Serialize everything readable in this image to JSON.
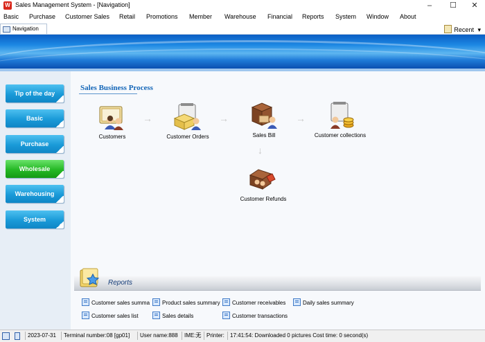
{
  "window": {
    "app_icon": "app-logo-icon",
    "app_icon_letter": "W",
    "title": "Sales Management System - [Navigation]",
    "controls": {
      "minimize": "–",
      "maximize": "☐",
      "close": "✕"
    }
  },
  "menu": [
    "Basic",
    "Purchase",
    "Customer Sales",
    "Retail",
    "Promotions",
    "Member",
    "Warehouse",
    "Financial",
    "Reports",
    "System",
    "Window",
    "About"
  ],
  "tabs": {
    "navigation": "Navigation",
    "recent": "Recent",
    "recent_arrow": "▾"
  },
  "sidebar": {
    "items": [
      {
        "label": "Tip of the day",
        "active": false
      },
      {
        "label": "Basic",
        "active": false
      },
      {
        "label": "Purchase",
        "active": false
      },
      {
        "label": "Wholesale",
        "active": true
      },
      {
        "label": "Warehousing",
        "active": false
      },
      {
        "label": "System",
        "active": false
      }
    ]
  },
  "main": {
    "section_title": "Sales Business Process",
    "steps": {
      "customers": "Customers",
      "customer_orders": "Customer Orders",
      "sales_bill": "Sales Bill",
      "customer_collections": "Customer collections",
      "customer_refunds": "Customer Refunds"
    },
    "arrow_right": "→",
    "arrow_down": "↓"
  },
  "reports": {
    "title": "Reports",
    "links": {
      "customer_sales_summary": "Customer sales summa",
      "product_sales_summary": "Product sales summary",
      "customer_receivables": "Customer receivables",
      "daily_sales_summary": "Daily sales summary",
      "customer_sales_list": "Customer sales list",
      "sales_details": "Sales details",
      "customer_transactions": "Customer transactions"
    }
  },
  "status": {
    "date": "2023-07-31",
    "terminal": "Terminal number:08 [gp01]",
    "user": "User name:888",
    "ime": "IME:无",
    "printer": "Printer:",
    "message": "17:41:54: Downloaded 0 pictures Cost time: 0 second(s)"
  },
  "colors": {
    "accent": "#1a9ad8",
    "active": "#25b825",
    "title_blue": "#1466b8",
    "banner": "#1c87e3"
  }
}
